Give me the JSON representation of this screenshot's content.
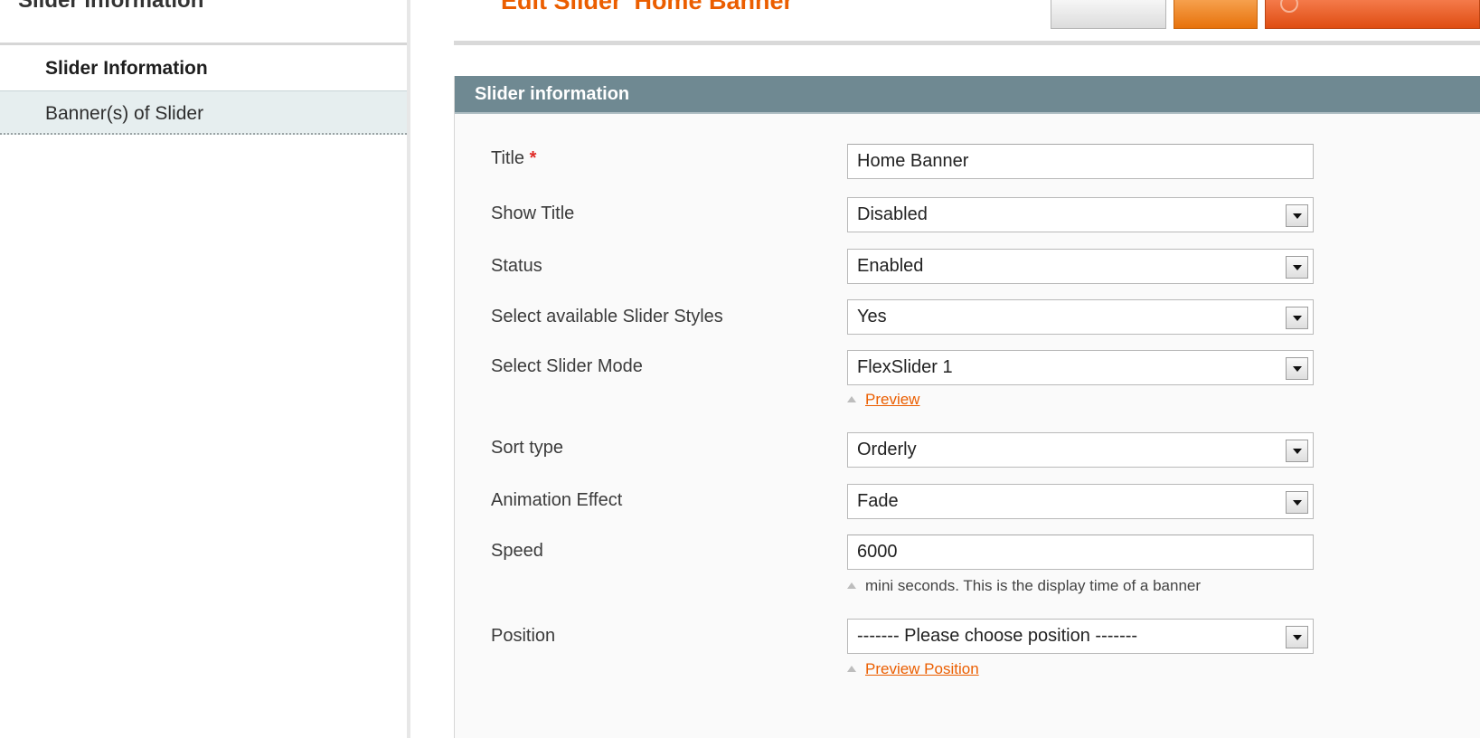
{
  "sidebar": {
    "heading": "Slider Information",
    "tabs": [
      {
        "label": "Slider Information",
        "active": true
      },
      {
        "label": "Banner(s) of Slider",
        "active": false
      }
    ]
  },
  "header": {
    "title": "Edit Slider 'Home Banner'"
  },
  "fieldset": {
    "title": "Slider information",
    "required_mark": "*",
    "fields": {
      "title": {
        "label": "Title",
        "value": "Home Banner"
      },
      "show_title": {
        "label": "Show Title",
        "value": "Disabled"
      },
      "status": {
        "label": "Status",
        "value": "Enabled"
      },
      "slider_styles": {
        "label": "Select available Slider Styles",
        "value": "Yes"
      },
      "slider_mode": {
        "label": "Select Slider Mode",
        "value": "FlexSlider 1",
        "note_link": "Preview"
      },
      "sort_type": {
        "label": "Sort type",
        "value": "Orderly"
      },
      "animation_effect": {
        "label": "Animation Effect",
        "value": "Fade"
      },
      "speed": {
        "label": "Speed",
        "value": "6000",
        "note": "mini seconds. This is the display time of a banner"
      },
      "position": {
        "label": "Position",
        "value": "------- Please choose position -------",
        "note_link": "Preview Position"
      }
    }
  },
  "colors": {
    "accent": "#eb5e00",
    "fieldset_header": "#6f8992",
    "inactive_tab": "#e6eeef"
  }
}
